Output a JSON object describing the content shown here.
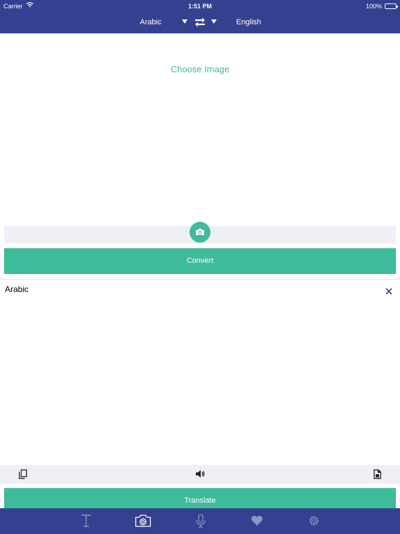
{
  "status_bar": {
    "carrier": "Carrier",
    "time": "1:51 PM",
    "battery": "100%"
  },
  "nav": {
    "source_language": "Arabic",
    "target_language": "English",
    "swap_icon": "swap-arrows-icon"
  },
  "image_panel": {
    "choose_image": "Choose Image",
    "camera_icon": "camera-icon"
  },
  "convert_button": "Convert",
  "result": {
    "language_label": "Arabic",
    "close_icon": "close-icon"
  },
  "toolbar": {
    "copy_icon": "copy-icon",
    "speak_icon": "speaker-icon",
    "paste_icon": "paste-icon"
  },
  "translate_button": "Translate",
  "tabs": [
    {
      "icon": "text-icon",
      "selected": false
    },
    {
      "icon": "camera-icon",
      "selected": true
    },
    {
      "icon": "microphone-icon",
      "selected": false
    },
    {
      "icon": "heart-icon",
      "selected": false
    },
    {
      "icon": "gear-icon",
      "selected": false
    }
  ],
  "colors": {
    "primary": "#344090",
    "accent": "#3dbb9a",
    "strip": "#efeff4"
  }
}
